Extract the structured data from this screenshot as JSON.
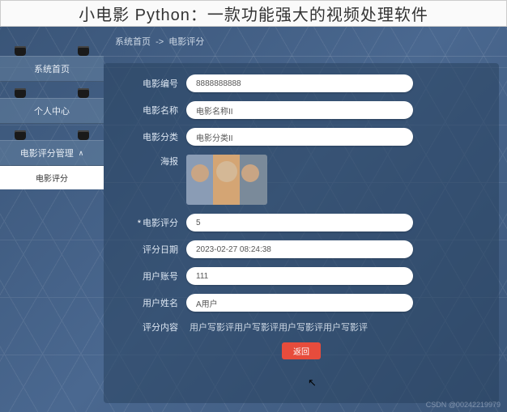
{
  "page_title": "小电影 Python：一款功能强大的视频处理软件",
  "sidebar": {
    "items": [
      {
        "label": "系统首页"
      },
      {
        "label": "个人中心"
      },
      {
        "label": "电影评分管理",
        "expanded": true,
        "children": [
          {
            "label": "电影评分"
          }
        ]
      }
    ]
  },
  "breadcrumb": {
    "home": "系统首页",
    "sep": "->",
    "current": "电影评分"
  },
  "form": {
    "movie_id": {
      "label": "电影编号",
      "value": "8888888888"
    },
    "movie_name": {
      "label": "电影名称",
      "value": "电影名称II"
    },
    "movie_cat": {
      "label": "电影分类",
      "value": "电影分类II"
    },
    "poster": {
      "label": "海报"
    },
    "rating": {
      "label": "电影评分",
      "value": "5"
    },
    "rate_date": {
      "label": "评分日期",
      "value": "2023-02-27 08:24:38"
    },
    "user_acc": {
      "label": "用户账号",
      "value": "111"
    },
    "user_name": {
      "label": "用户姓名",
      "value": "A用户"
    },
    "content": {
      "label": "评分内容",
      "value": "用户写影评用户写影评用户写影评用户写影评"
    },
    "back_btn": "返回"
  },
  "watermark": "CSDN @00242219979"
}
